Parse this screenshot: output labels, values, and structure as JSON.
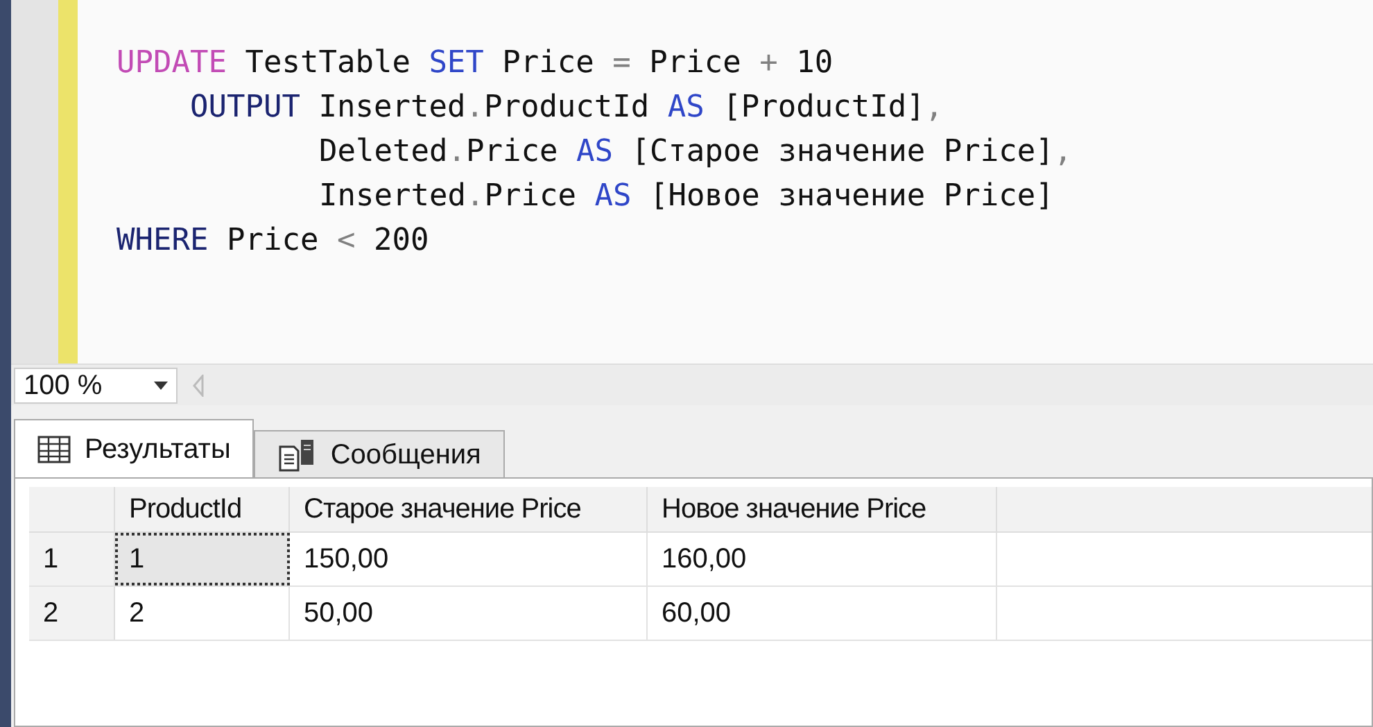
{
  "editor": {
    "lines": [
      {
        "kind": "statement",
        "tokens": [
          {
            "kind": "function",
            "text": "UPDATE"
          },
          {
            "kind": "text",
            "text": " TestTable "
          },
          {
            "kind": "keyword",
            "text": "SET"
          },
          {
            "kind": "text",
            "text": " Price "
          },
          {
            "kind": "operator",
            "text": "="
          },
          {
            "kind": "text",
            "text": " Price "
          },
          {
            "kind": "operator",
            "text": "+"
          },
          {
            "kind": "text",
            "text": " 10"
          }
        ]
      },
      {
        "kind": "clause",
        "tokens": [
          {
            "kind": "statement",
            "text": "OUTPUT"
          },
          {
            "kind": "text",
            "text": " Inserted"
          },
          {
            "kind": "operator",
            "text": "."
          },
          {
            "kind": "text",
            "text": "ProductId "
          },
          {
            "kind": "keyword",
            "text": "AS"
          },
          {
            "kind": "text",
            "text": " [ProductId]"
          },
          {
            "kind": "operator",
            "text": ","
          }
        ]
      },
      {
        "kind": "continuation",
        "tokens": [
          {
            "kind": "text",
            "text": "Deleted"
          },
          {
            "kind": "operator",
            "text": "."
          },
          {
            "kind": "text",
            "text": "Price "
          },
          {
            "kind": "keyword",
            "text": "AS"
          },
          {
            "kind": "text",
            "text": " [Старое значение Price]"
          },
          {
            "kind": "operator",
            "text": ","
          }
        ]
      },
      {
        "kind": "continuation",
        "tokens": [
          {
            "kind": "text",
            "text": "Inserted"
          },
          {
            "kind": "operator",
            "text": "."
          },
          {
            "kind": "text",
            "text": "Price "
          },
          {
            "kind": "keyword",
            "text": "AS"
          },
          {
            "kind": "text",
            "text": " [Новое значение Price]"
          }
        ]
      },
      {
        "kind": "statement",
        "tokens": [
          {
            "kind": "statement",
            "text": "WHERE"
          },
          {
            "kind": "text",
            "text": " Price "
          },
          {
            "kind": "operator",
            "text": "<"
          },
          {
            "kind": "text",
            "text": " 200"
          }
        ]
      }
    ]
  },
  "zoom": {
    "value": "100 %"
  },
  "tabs": [
    {
      "label": "Результаты",
      "selected": true,
      "kind": "grid"
    },
    {
      "label": "Сообщения",
      "selected": false,
      "kind": "messages"
    }
  ],
  "table": {
    "columns": [
      "ProductId",
      "Старое значение Price",
      "Новое значение Price"
    ],
    "rows": [
      {
        "number": "1",
        "cells": [
          {
            "text": "1",
            "selected": true
          },
          {
            "text": "150,00",
            "selected": false
          },
          {
            "text": "160,00",
            "selected": false
          }
        ]
      },
      {
        "number": "2",
        "cells": [
          {
            "text": "2",
            "selected": false
          },
          {
            "text": "50,00",
            "selected": false
          },
          {
            "text": "60,00",
            "selected": false
          }
        ]
      }
    ]
  }
}
